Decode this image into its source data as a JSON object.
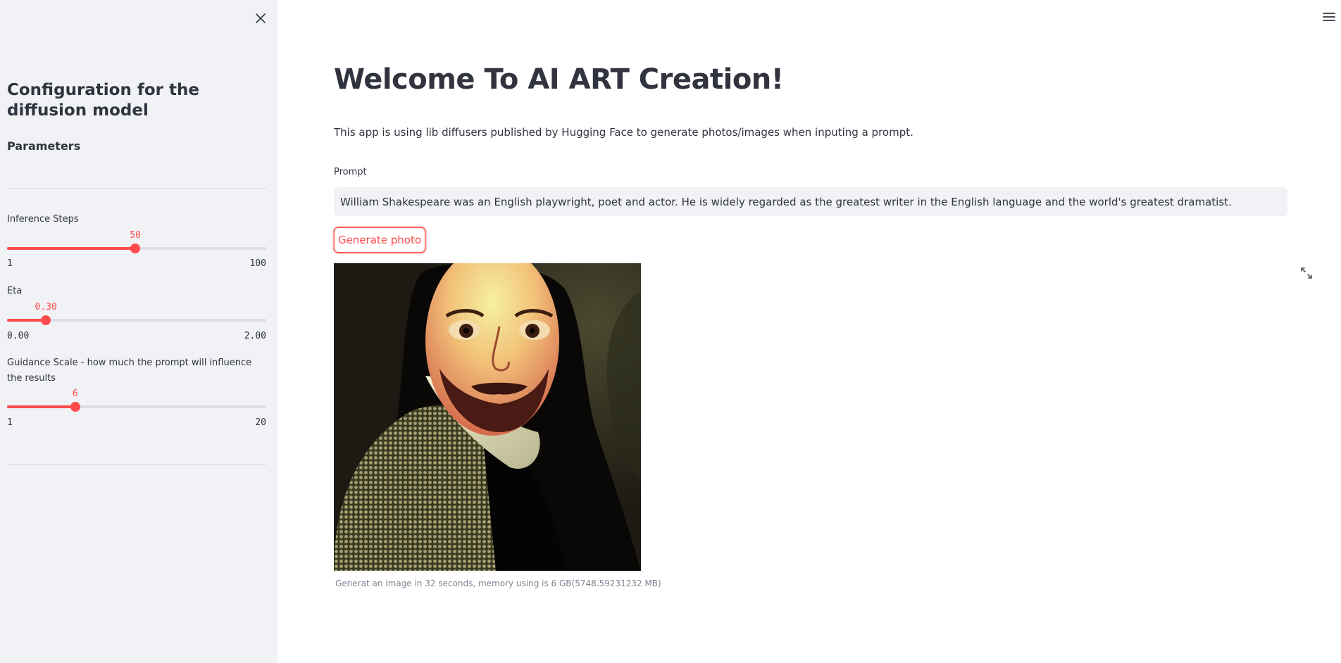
{
  "sidebar": {
    "title": "Configuration for the diffusion model",
    "subtitle": "Parameters",
    "sliders": [
      {
        "label": "Inference Steps",
        "value": "50",
        "min": "1",
        "max": "100",
        "fraction": 0.495
      },
      {
        "label": "Eta",
        "value": "0.30",
        "min": "0.00",
        "max": "2.00",
        "fraction": 0.15
      },
      {
        "label": "Guidance Scale - how much the prompt will influence the results",
        "value": "6",
        "min": "1",
        "max": "20",
        "fraction": 0.263
      }
    ]
  },
  "main": {
    "title": "Welcome To AI ART Creation!",
    "description": "This app is using lib diffusers published by Hugging Face to generate photos/images when inputing a prompt.",
    "prompt_label": "Prompt",
    "prompt_value": "William Shakespeare was an English playwright, poet and actor. He is widely regarded as the greatest writer in the English language and the world's greatest dramatist.",
    "generate_label": "Generate photo",
    "caption": "Generat an image in 32 seconds, memory using is 6 GB(5748.59231232 MB)"
  },
  "colors": {
    "accent": "#ff4b4b",
    "sidebar_bg": "#f0f2f6",
    "text": "#31333f"
  },
  "icons": {
    "close": "close-icon",
    "menu": "hamburger-menu-icon",
    "expand": "fullscreen-expand-icon"
  }
}
